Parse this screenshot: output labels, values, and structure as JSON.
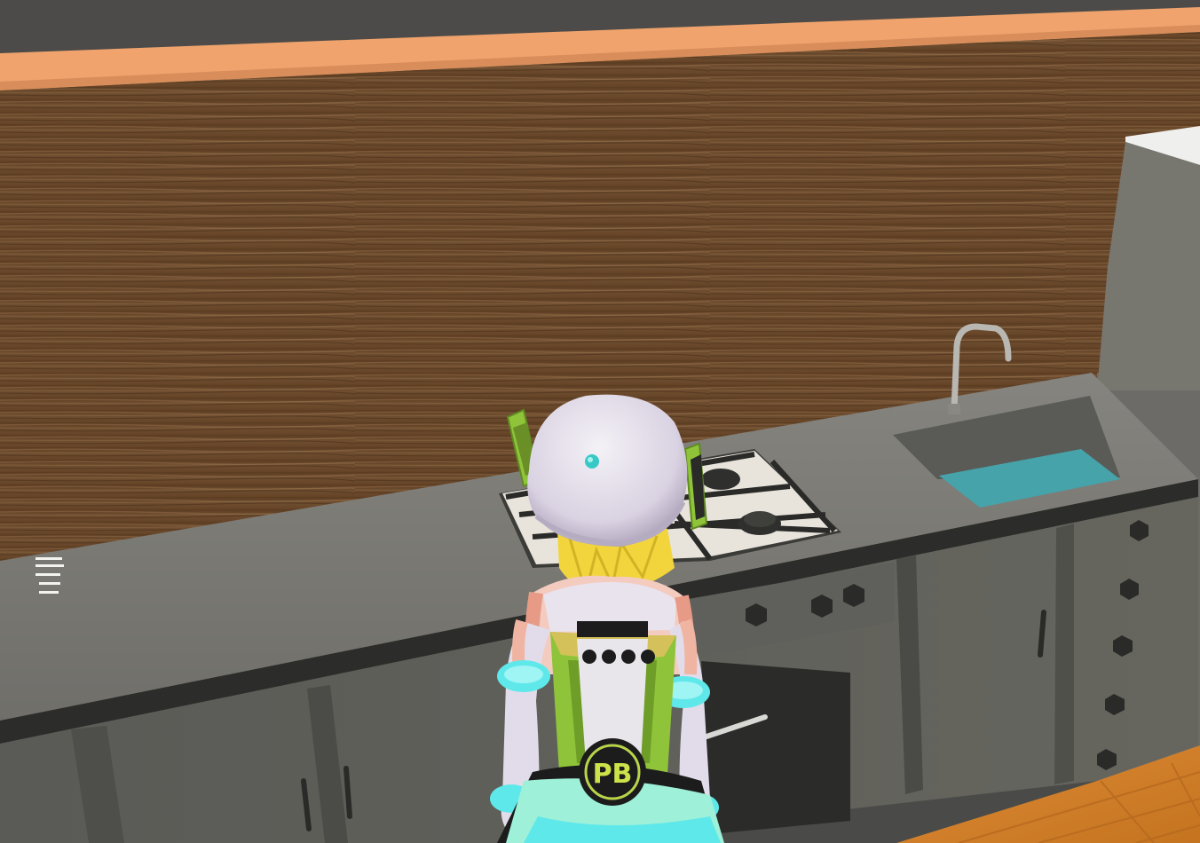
{
  "scene": {
    "description_type": "3d-game-viewport",
    "environment": "kitchen",
    "character": {
      "emblem_text": "PB",
      "colors": {
        "hat": "#e4dfea",
        "hair": "#f2d53c",
        "outfit_green": "#8fc43a",
        "accent_cyan": "#5fe8ea",
        "outfit_black": "#1c1c1c"
      }
    },
    "colors": {
      "ceiling": "#4b4b49",
      "wall_trim": "#f0a36c",
      "wood_panel": "#6a4a2c",
      "countertop": "#7c7b76",
      "cabinet": "#5c5c58",
      "sink_water": "#46a3aa",
      "floor_tile": "#d3822e"
    },
    "icons": [
      "faucet-icon",
      "stove-knob-icon"
    ]
  }
}
